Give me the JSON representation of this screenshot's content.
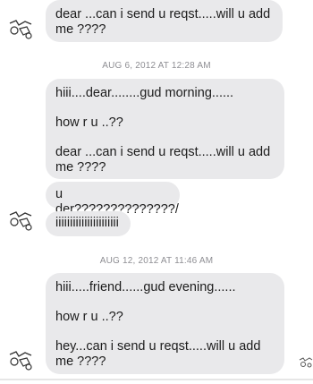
{
  "messages": {
    "m1": {
      "text": "dear ...can i send u reqst.....will u add me ????"
    },
    "ts1": "AUG 6, 2012 AT 12:28 AM",
    "m2": {
      "line1": "hiii....dear........gud morning......",
      "line2": "how r u ..??",
      "line3": "dear ...can i send u reqst.....will u add me ????"
    },
    "m3": {
      "text": "u der??????????????/"
    },
    "m4": {
      "text": "iiiiiiiiiiiiiiiiiiiiii"
    },
    "ts2": "AUG 12, 2012 AT 11:46 AM",
    "m5": {
      "line1": "hiii.....friend......gud evening......",
      "line2": "how r u ..??",
      "line3": "hey...can i send u reqst.....will u add me ????"
    }
  },
  "icons": {
    "avatar": "doodle-avatar-icon",
    "thumb": "doodle-small-icon"
  }
}
